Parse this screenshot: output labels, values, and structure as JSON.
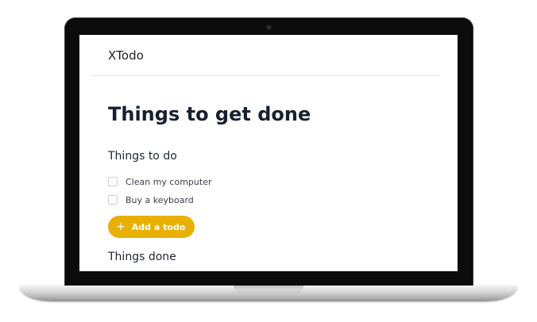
{
  "app": {
    "brand": "XTodo"
  },
  "main": {
    "title": "Things to get done",
    "todo_section": {
      "title": "Things to do",
      "items": [
        {
          "label": "Clean my computer",
          "checked": false
        },
        {
          "label": "Buy a keyboard",
          "checked": false
        }
      ]
    },
    "add_button": {
      "icon": "plus-icon",
      "icon_glyph": "+",
      "label": "Add a todo"
    },
    "done_section": {
      "title": "Things done"
    }
  },
  "colors": {
    "accent": "#e8b003",
    "title": "#17202e",
    "bezel": "#0b0b0b"
  }
}
